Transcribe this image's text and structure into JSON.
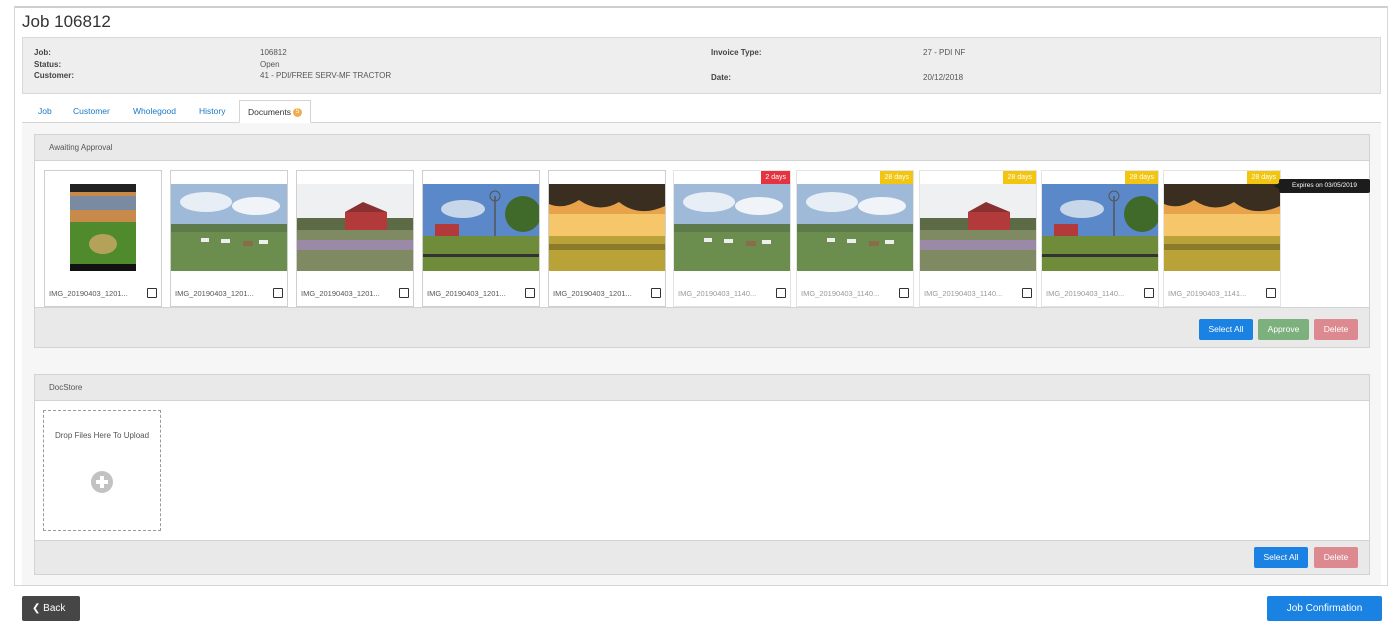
{
  "page": {
    "title": "Job 106812"
  },
  "info": {
    "job_label": "Job:",
    "job_value": "106812",
    "status_label": "Status:",
    "status_value": "Open",
    "customer_label": "Customer:",
    "customer_value": "41 - PDI/FREE SERV-MF TRACTOR",
    "invoice_type_label": "Invoice Type:",
    "invoice_type_value": "27 - PDI NF",
    "date_label": "Date:",
    "date_value": "20/12/2018"
  },
  "tabs": [
    {
      "label": "Job"
    },
    {
      "label": "Customer"
    },
    {
      "label": "Wholegood"
    },
    {
      "label": "History"
    },
    {
      "label": "Documents",
      "badge": "5"
    }
  ],
  "awaiting": {
    "title": "Awaiting Approval",
    "items": [
      {
        "caption": "IMG_20190403_1201...",
        "badge": ""
      },
      {
        "caption": "IMG_20190403_1201...",
        "badge": ""
      },
      {
        "caption": "IMG_20190403_1201...",
        "badge": ""
      },
      {
        "caption": "IMG_20190403_1201...",
        "badge": ""
      },
      {
        "caption": "IMG_20190403_1201...",
        "badge": ""
      },
      {
        "caption": "IMG_20190403_1140...",
        "badge": "2 days",
        "badge_color": "#e5343f"
      },
      {
        "caption": "IMG_20190403_1140...",
        "badge": "28 days",
        "badge_color": "#f2c511"
      },
      {
        "caption": "IMG_20190403_1140...",
        "badge": "28 days",
        "badge_color": "#f2c511"
      },
      {
        "caption": "IMG_20190403_1140...",
        "badge": "28 days",
        "badge_color": "#f2c511"
      },
      {
        "caption": "IMG_20190403_1141...",
        "badge": "28 days",
        "badge_color": "#f2c511"
      }
    ],
    "tooltip": "Expires on 03/05/2019",
    "select_all": "Select All",
    "approve": "Approve",
    "delete": "Delete"
  },
  "docstore": {
    "title": "DocStore",
    "drop_text": "Drop Files Here To Upload",
    "select_all": "Select All",
    "delete": "Delete"
  },
  "footer": {
    "back": "Back",
    "confirm": "Job Confirmation"
  },
  "colors": {
    "primary": "#1a82e2",
    "approve": "#7cb07c",
    "delete": "#dc8a8f",
    "badge_red": "#e5343f",
    "badge_yellow": "#f2c511"
  }
}
